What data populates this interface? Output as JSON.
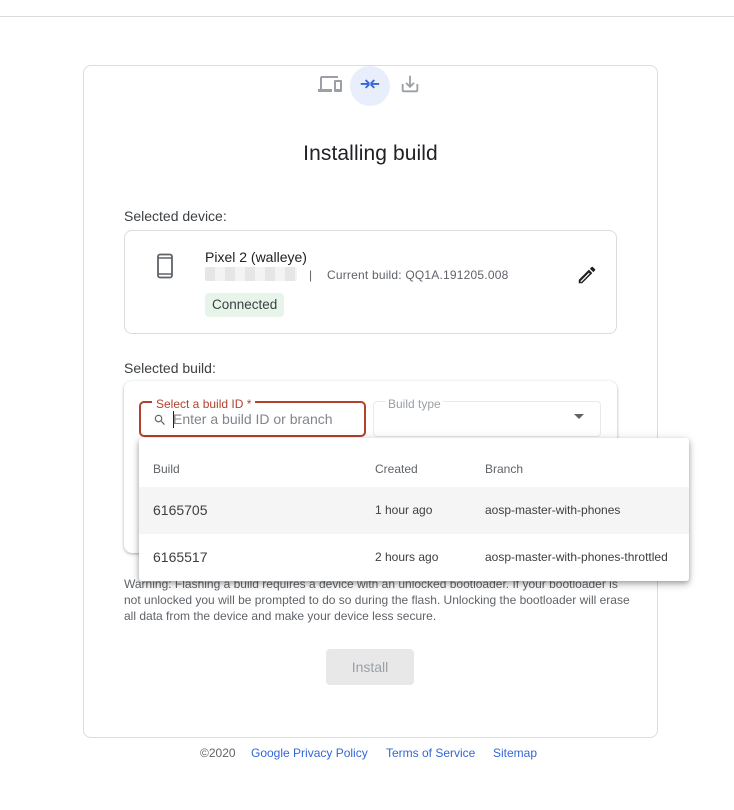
{
  "stepper": {
    "steps": [
      {
        "icon": "devices-icon",
        "active": false
      },
      {
        "icon": "connect-arrows-icon",
        "active": true
      },
      {
        "icon": "download-icon",
        "active": false
      }
    ],
    "accent": "#3367d6"
  },
  "title": "Installing build",
  "device_section": {
    "label": "Selected device:",
    "name": "Pixel 2 (walleye)",
    "separator": "|",
    "current_build": "Current build: QQ1A.191205.008",
    "status": "Connected",
    "status_color": "#e6f4ea"
  },
  "build_section": {
    "label": "Selected build:",
    "build_id_label": "Select a build ID *",
    "build_id_placeholder": "Enter a build ID or branch",
    "build_type_label": "Build type",
    "error_color": "#b3412c"
  },
  "dropdown": {
    "headers": {
      "build": "Build",
      "created": "Created",
      "branch": "Branch"
    },
    "rows": [
      {
        "build": "6165705",
        "created": "1 hour ago",
        "branch": "aosp-master-with-phones"
      },
      {
        "build": "6165517",
        "created": "2 hours ago",
        "branch": "aosp-master-with-phones-throttled"
      }
    ]
  },
  "warning": "Warning: Flashing a build requires a device with an unlocked bootloader. If your bootloader is not unlocked you will be prompted to do so during the flash. Unlocking the bootloader will erase all data from the device and make your device less secure.",
  "install_label": "Install",
  "footer": {
    "copyright": "©2020",
    "links": [
      "Google Privacy Policy",
      "Terms of Service",
      "Sitemap"
    ]
  }
}
